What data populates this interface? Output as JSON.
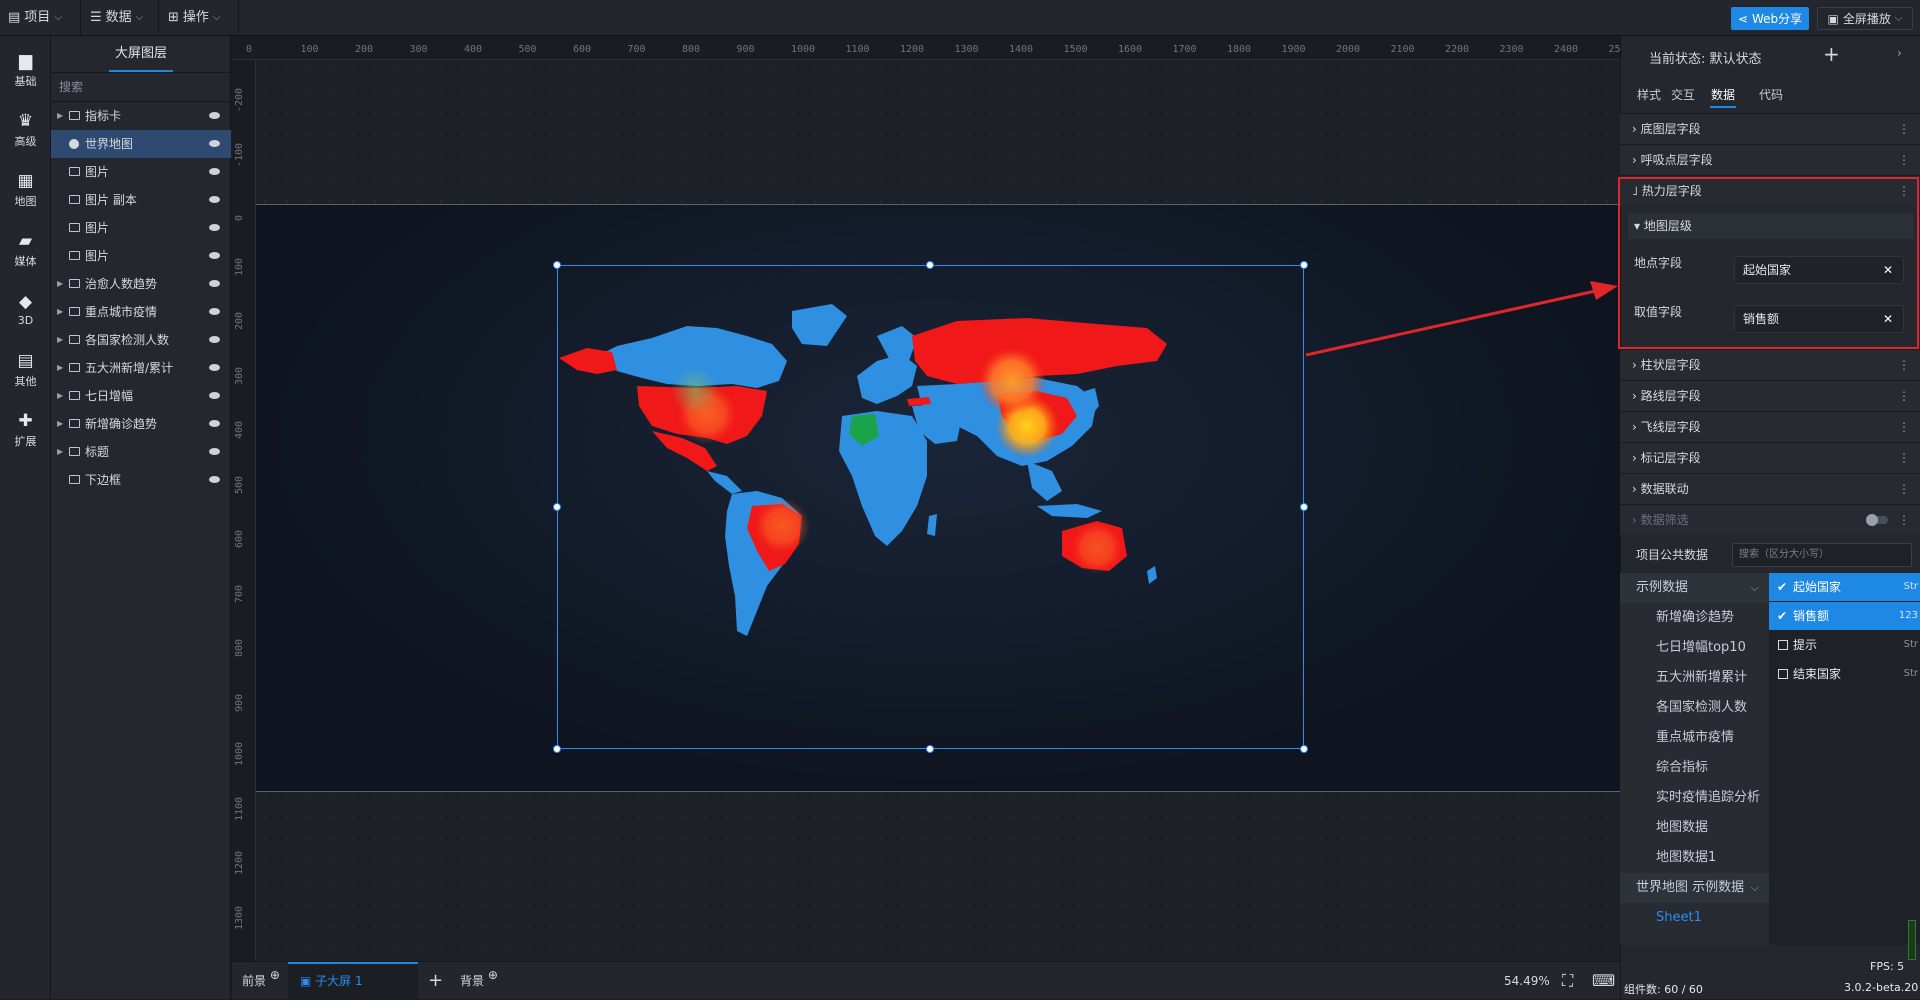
{
  "topbar": {
    "menus": [
      {
        "label": "项目",
        "icon": "file-icon"
      },
      {
        "label": "数据",
        "icon": "database-icon"
      },
      {
        "label": "操作",
        "icon": "grid-icon"
      }
    ],
    "web_share": "Web分享",
    "fullscreen": "全屏播放"
  },
  "leftbar": {
    "items": [
      {
        "label": "基础",
        "icon": "bar-chart-icon"
      },
      {
        "label": "高级",
        "icon": "crown-icon"
      },
      {
        "label": "地图",
        "icon": "map-icon"
      },
      {
        "label": "媒体",
        "icon": "media-icon"
      },
      {
        "label": "3D",
        "icon": "cube-icon"
      },
      {
        "label": "其他",
        "icon": "other-icon"
      },
      {
        "label": "扩展",
        "icon": "puzzle-icon"
      }
    ]
  },
  "layers": {
    "title": "大屏图层",
    "search_placeholder": "搜索",
    "items": [
      {
        "label": "指标卡",
        "type": "group",
        "expandable": true
      },
      {
        "label": "世界地图",
        "type": "globe",
        "expandable": false,
        "selected": true
      },
      {
        "label": "图片",
        "type": "image",
        "expandable": false
      },
      {
        "label": "图片 副本",
        "type": "image",
        "expandable": false
      },
      {
        "label": "图片",
        "type": "image",
        "expandable": false
      },
      {
        "label": "图片",
        "type": "image",
        "expandable": false
      },
      {
        "label": "治愈人数趋势",
        "type": "group",
        "expandable": true
      },
      {
        "label": "重点城市疫情",
        "type": "group",
        "expandable": true
      },
      {
        "label": "各国家检测人数",
        "type": "group",
        "expandable": true
      },
      {
        "label": "五大洲新增/累计",
        "type": "group",
        "expandable": true
      },
      {
        "label": "七日增幅",
        "type": "group",
        "expandable": true
      },
      {
        "label": "新增确诊趋势",
        "type": "group",
        "expandable": true
      },
      {
        "label": "标题",
        "type": "group",
        "expandable": true
      },
      {
        "label": "下边框",
        "type": "image",
        "expandable": false
      }
    ]
  },
  "ruler": {
    "top": [
      "0",
      "100",
      "200",
      "300",
      "400",
      "500",
      "600",
      "700",
      "800",
      "900",
      "1000",
      "1100",
      "1200",
      "1300",
      "1400",
      "1500",
      "1600",
      "1700",
      "1800",
      "1900",
      "2000",
      "2100",
      "2200",
      "2300",
      "2400",
      "25"
    ],
    "left": [
      "-200",
      "-100",
      "0",
      "100",
      "200",
      "300",
      "400",
      "500",
      "600",
      "700",
      "800",
      "900",
      "1000",
      "1100",
      "1200",
      "1300"
    ]
  },
  "bottombar": {
    "foreground": "前景",
    "active_tab": "子大屏 1",
    "background": "背景",
    "zoom": "54.49%"
  },
  "rightpanel": {
    "state_label": "当前状态: 默认状态",
    "tabs": [
      "样式",
      "交互",
      "数据",
      "代码"
    ],
    "active_tab": "数据",
    "sections_top": [
      "底图层字段",
      "呼吸点层字段"
    ],
    "hot_section": "热力层字段",
    "sub_section": "地图层级",
    "location_field_label": "地点字段",
    "location_field_value": "起始国家",
    "value_field_label": "取值字段",
    "value_field_value": "销售额",
    "sections_bottom": [
      "柱状层字段",
      "路线层字段",
      "飞线层字段",
      "标记层字段",
      "数据联动"
    ],
    "data_filter": "数据筛选",
    "public_data_title": "项目公共数据",
    "public_search_placeholder": "搜索（区分大小写）",
    "datasets": [
      {
        "label": "示例数据",
        "kind": "group"
      },
      {
        "label": "新增确诊趋势",
        "kind": "item"
      },
      {
        "label": "七日增幅top10",
        "kind": "item"
      },
      {
        "label": "五大洲新增累计",
        "kind": "item"
      },
      {
        "label": "各国家检测人数",
        "kind": "item"
      },
      {
        "label": "重点城市疫情",
        "kind": "item"
      },
      {
        "label": "综合指标",
        "kind": "item"
      },
      {
        "label": "实时疫情追踪分析",
        "kind": "item"
      },
      {
        "label": "地图数据",
        "kind": "item"
      },
      {
        "label": "地图数据1",
        "kind": "item"
      },
      {
        "label": "世界地图 示例数据",
        "kind": "group"
      },
      {
        "label": "Sheet1",
        "kind": "blue"
      }
    ],
    "fields": [
      {
        "label": "起始国家",
        "checked": true,
        "type": "Str"
      },
      {
        "label": "销售额",
        "checked": true,
        "type": "123"
      },
      {
        "label": "提示",
        "checked": false,
        "type": "Str"
      },
      {
        "label": "结束国家",
        "checked": false,
        "type": "Str"
      }
    ],
    "fps": "FPS: 5",
    "component_count": "组件数: 60 / 60",
    "version": "3.0.2-beta.20"
  },
  "colors": {
    "accent": "#1e88e5",
    "highlight": "#e0262b",
    "map_land": "#2f8fe0",
    "map_hot": "#f01818",
    "map_green": "#1aa34a"
  }
}
